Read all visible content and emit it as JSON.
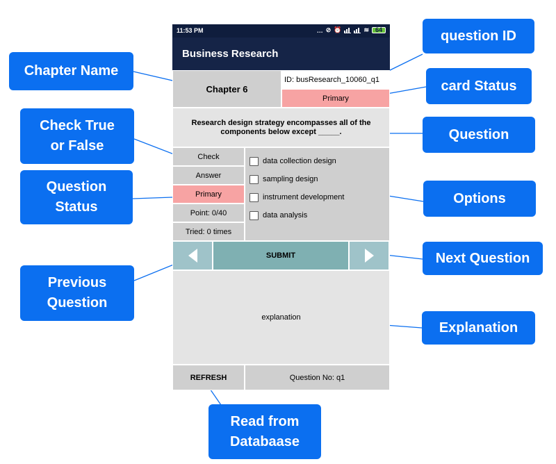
{
  "status_bar": {
    "time": "11:53 PM",
    "battery": "64"
  },
  "app": {
    "title": "Business Research"
  },
  "card": {
    "chapter": "Chapter 6",
    "question_id": "ID: busResearch_10060_q1",
    "card_status": "Primary"
  },
  "question": {
    "text": "Research design strategy encompasses all of the components below except _____."
  },
  "left_panel": {
    "check_label": "Check",
    "answer_label": "Answer",
    "question_status": "Primary",
    "point": "Point: 0/40",
    "tried": "Tried: 0 times"
  },
  "options": [
    {
      "label": "data collection design"
    },
    {
      "label": "sampling design"
    },
    {
      "label": "instrument development"
    },
    {
      "label": "data analysis"
    }
  ],
  "nav": {
    "submit_label": "SUBMIT"
  },
  "explanation": {
    "text": "explanation"
  },
  "footer": {
    "refresh_label": "REFRESH",
    "question_no": "Question No: q1"
  },
  "callouts": {
    "question_id": "question ID",
    "chapter_name": "Chapter Name",
    "card_status": "card Status",
    "check_true_false": "Check True\nor False",
    "question": "Question",
    "question_status": "Question\nStatus",
    "options": "Options",
    "next_question": "Next Question",
    "previous_question": "Previous\nQuestion",
    "explanation": "Explanation",
    "read_from_database": "Read from\nDatabaase"
  },
  "colors": {
    "callout": "#0b6ff0",
    "app_bar": "#152447",
    "status_pink": "#f7a3a3",
    "nav_teal": "#9fc3c9",
    "submit_teal": "#7fb0b2"
  }
}
